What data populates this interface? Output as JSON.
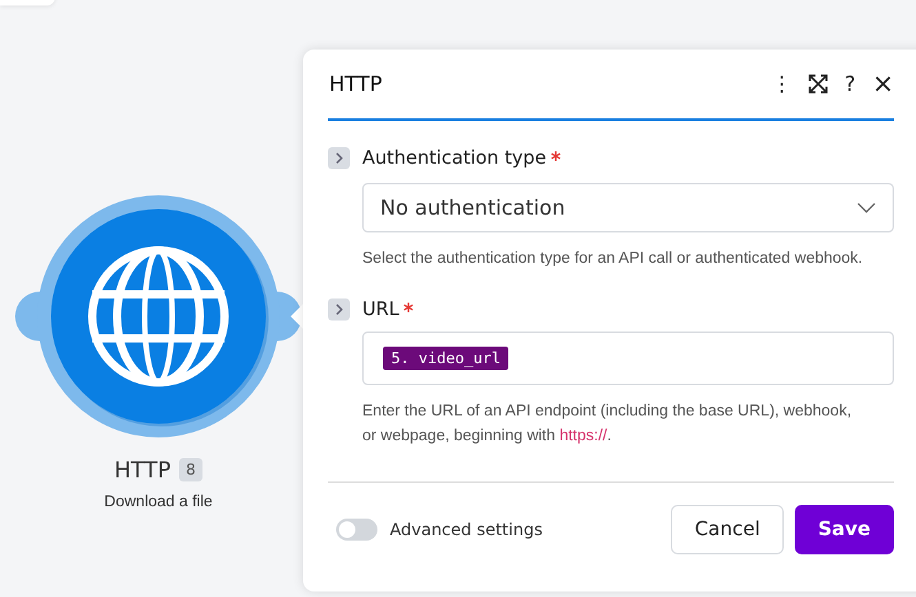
{
  "node": {
    "title": "HTTP",
    "badge": "8",
    "subtitle": "Download a file"
  },
  "panel": {
    "title": "HTTP",
    "header_icons": [
      "⋮",
      "?",
      "×"
    ],
    "fields": [
      {
        "kind": "select",
        "label": "Authentication type",
        "required": true,
        "value": "No authentication",
        "help": "Select the authentication type for an API call or authenticated webhook."
      },
      {
        "kind": "mapping",
        "label": "URL",
        "required": true,
        "token": "5. video_url",
        "help": "Enter the URL of an API endpoint (including the base URL), webhook, or webpage, beginning with ",
        "help_link": "https://",
        "help_end": "."
      }
    ],
    "advanced": {
      "label": "Advanced settings",
      "on": false
    },
    "buttons": [
      {
        "label": "Cancel",
        "kind": "secondary"
      },
      {
        "label": "Save",
        "kind": "primary"
      }
    ]
  }
}
